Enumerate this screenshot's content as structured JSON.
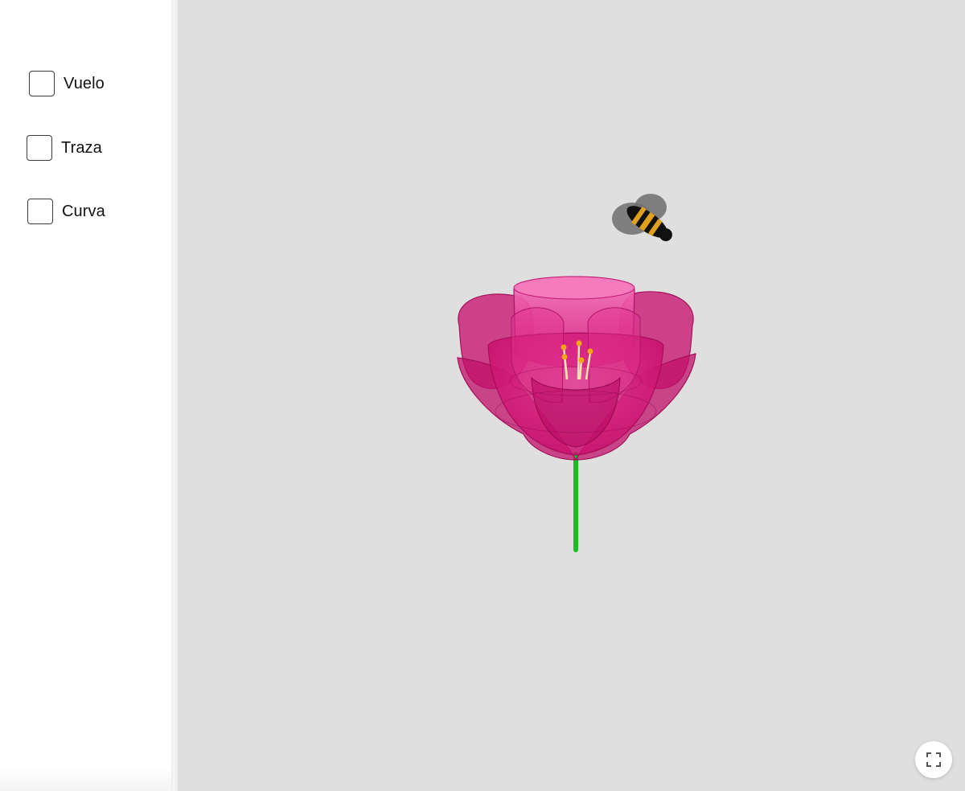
{
  "controls": {
    "checkboxes": [
      {
        "label": "Vuelo",
        "checked": false
      },
      {
        "label": "Traza",
        "checked": false
      },
      {
        "label": "Curva",
        "checked": false
      }
    ]
  },
  "scene": {
    "background_color": "#dfdfdf",
    "flower_color": "#d6157a",
    "flower_inner_color": "#f06ab4",
    "stem_color": "#1dbb25",
    "stamen_color": "#f2a617",
    "bee_stripe_color": "#e0a020",
    "fullscreen_icon": "fullscreen-icon"
  }
}
